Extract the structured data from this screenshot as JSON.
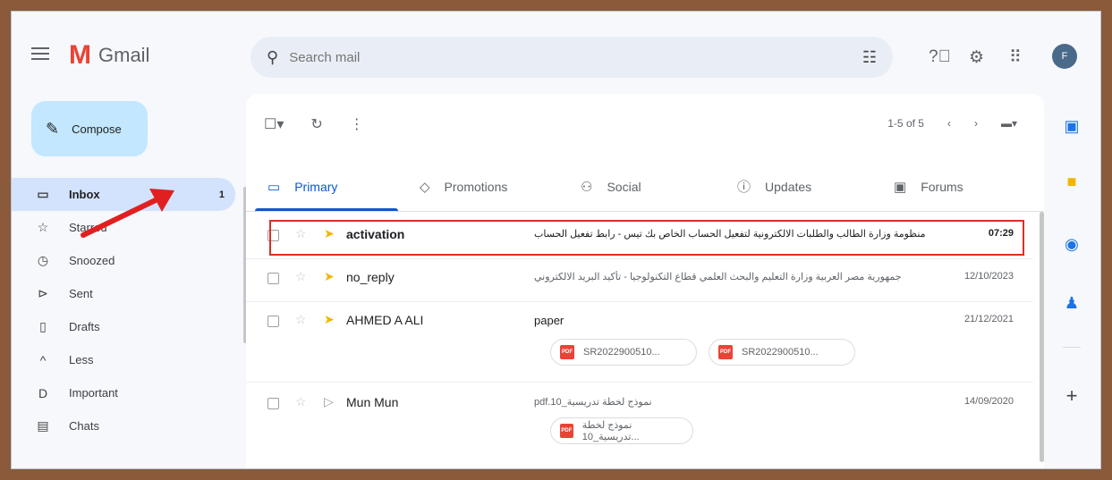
{
  "header": {
    "app_name": "Gmail",
    "logo_letter": "M",
    "search_placeholder": "Search mail",
    "avatar_initial": "F"
  },
  "sidebar": {
    "compose_label": "Compose",
    "items": [
      {
        "label": "Inbox",
        "count": "1",
        "icon": "inbox-icon",
        "glyph": "▭"
      },
      {
        "label": "Starred",
        "count": "",
        "icon": "star-icon",
        "glyph": "☆"
      },
      {
        "label": "Snoozed",
        "count": "",
        "icon": "clock-icon",
        "glyph": "◷"
      },
      {
        "label": "Sent",
        "count": "",
        "icon": "send-icon",
        "glyph": "⊳"
      },
      {
        "label": "Drafts",
        "count": "",
        "icon": "draft-icon",
        "glyph": "▯"
      },
      {
        "label": "Less",
        "count": "",
        "icon": "chevron-up-icon",
        "glyph": "^"
      },
      {
        "label": "Important",
        "count": "",
        "icon": "important-icon",
        "glyph": "D"
      },
      {
        "label": "Chats",
        "count": "",
        "icon": "chat-icon",
        "glyph": "▤"
      }
    ]
  },
  "toolbar": {
    "page_info": "1-5 of 5"
  },
  "tabs": [
    {
      "label": "Primary",
      "icon": "inbox-tab-icon",
      "glyph": "▭"
    },
    {
      "label": "Promotions",
      "icon": "tag-icon",
      "glyph": "◇"
    },
    {
      "label": "Social",
      "icon": "people-icon",
      "glyph": "⚇"
    },
    {
      "label": "Updates",
      "icon": "info-icon",
      "glyph": "ⓘ"
    },
    {
      "label": "Forums",
      "icon": "forum-icon",
      "glyph": "▣"
    }
  ],
  "emails": [
    {
      "sender": "activation",
      "subject": "منظومة وزارة الطالب والطلبات الالكترونية لتفعيل الحساب الخاص بك تيس - رابط تفعيل الحساب",
      "date": "07:29",
      "unread": true
    },
    {
      "sender": "no_reply",
      "subject": "جمهورية مصر العربية وزارة التعليم والبحث العلمي قطاع التكنولوجيا - تأكيد البريد الالكتروني",
      "date": "12/10/2023",
      "unread": false
    },
    {
      "sender": "AHMED A ALI",
      "subject": "paper",
      "date": "21/12/2021",
      "unread": false,
      "attachments": [
        "SR2022900510...",
        "SR2022900510..."
      ]
    },
    {
      "sender": "Mun Mun",
      "subject": "pdf.10_نموذج لخطة تدريسية",
      "date": "14/09/2020",
      "unread": false,
      "attachments": [
        "نموذج لخطة تدريسية_10..."
      ]
    }
  ],
  "colors": {
    "accent": "#0b57d0",
    "compose_bg": "#c2e7ff",
    "active_nav": "#d3e3fd",
    "highlight_box": "#d93025",
    "annotation_arrow": "#e02020"
  }
}
